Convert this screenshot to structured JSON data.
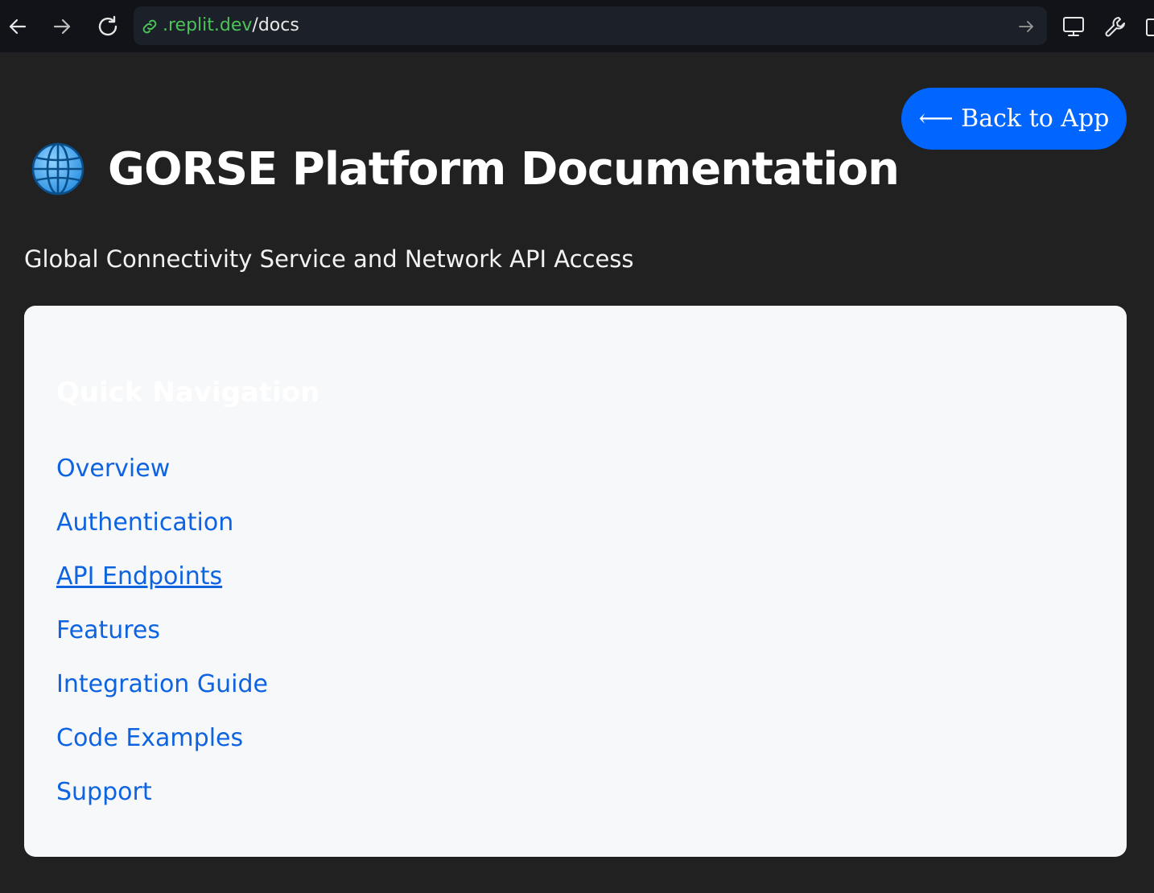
{
  "browser": {
    "url_host": ".replit.dev",
    "url_path": "/docs",
    "icons": [
      "back-arrow-icon",
      "forward-arrow-icon",
      "reload-icon",
      "link-icon",
      "go-arrow-icon",
      "monitor-icon",
      "wrench-icon",
      "panel-icon"
    ]
  },
  "header": {
    "back_button_label": "⟵ Back to App",
    "globe_icon": "globe-icon",
    "title": "GORSE Platform Documentation",
    "subtitle": "Global Connectivity Service and Network API Access"
  },
  "nav": {
    "heading": "Quick Navigation",
    "links": [
      {
        "label": "Overview"
      },
      {
        "label": "Authentication"
      },
      {
        "label": "API Endpoints",
        "hovered": true
      },
      {
        "label": "Features"
      },
      {
        "label": "Integration Guide"
      },
      {
        "label": "Code Examples"
      },
      {
        "label": "Support"
      }
    ]
  },
  "colors": {
    "page_bg": "#212121",
    "accent": "#0066ff",
    "link": "#0d63e0",
    "card_bg": "#f7f8fa",
    "url_host": "#4cc35a"
  }
}
